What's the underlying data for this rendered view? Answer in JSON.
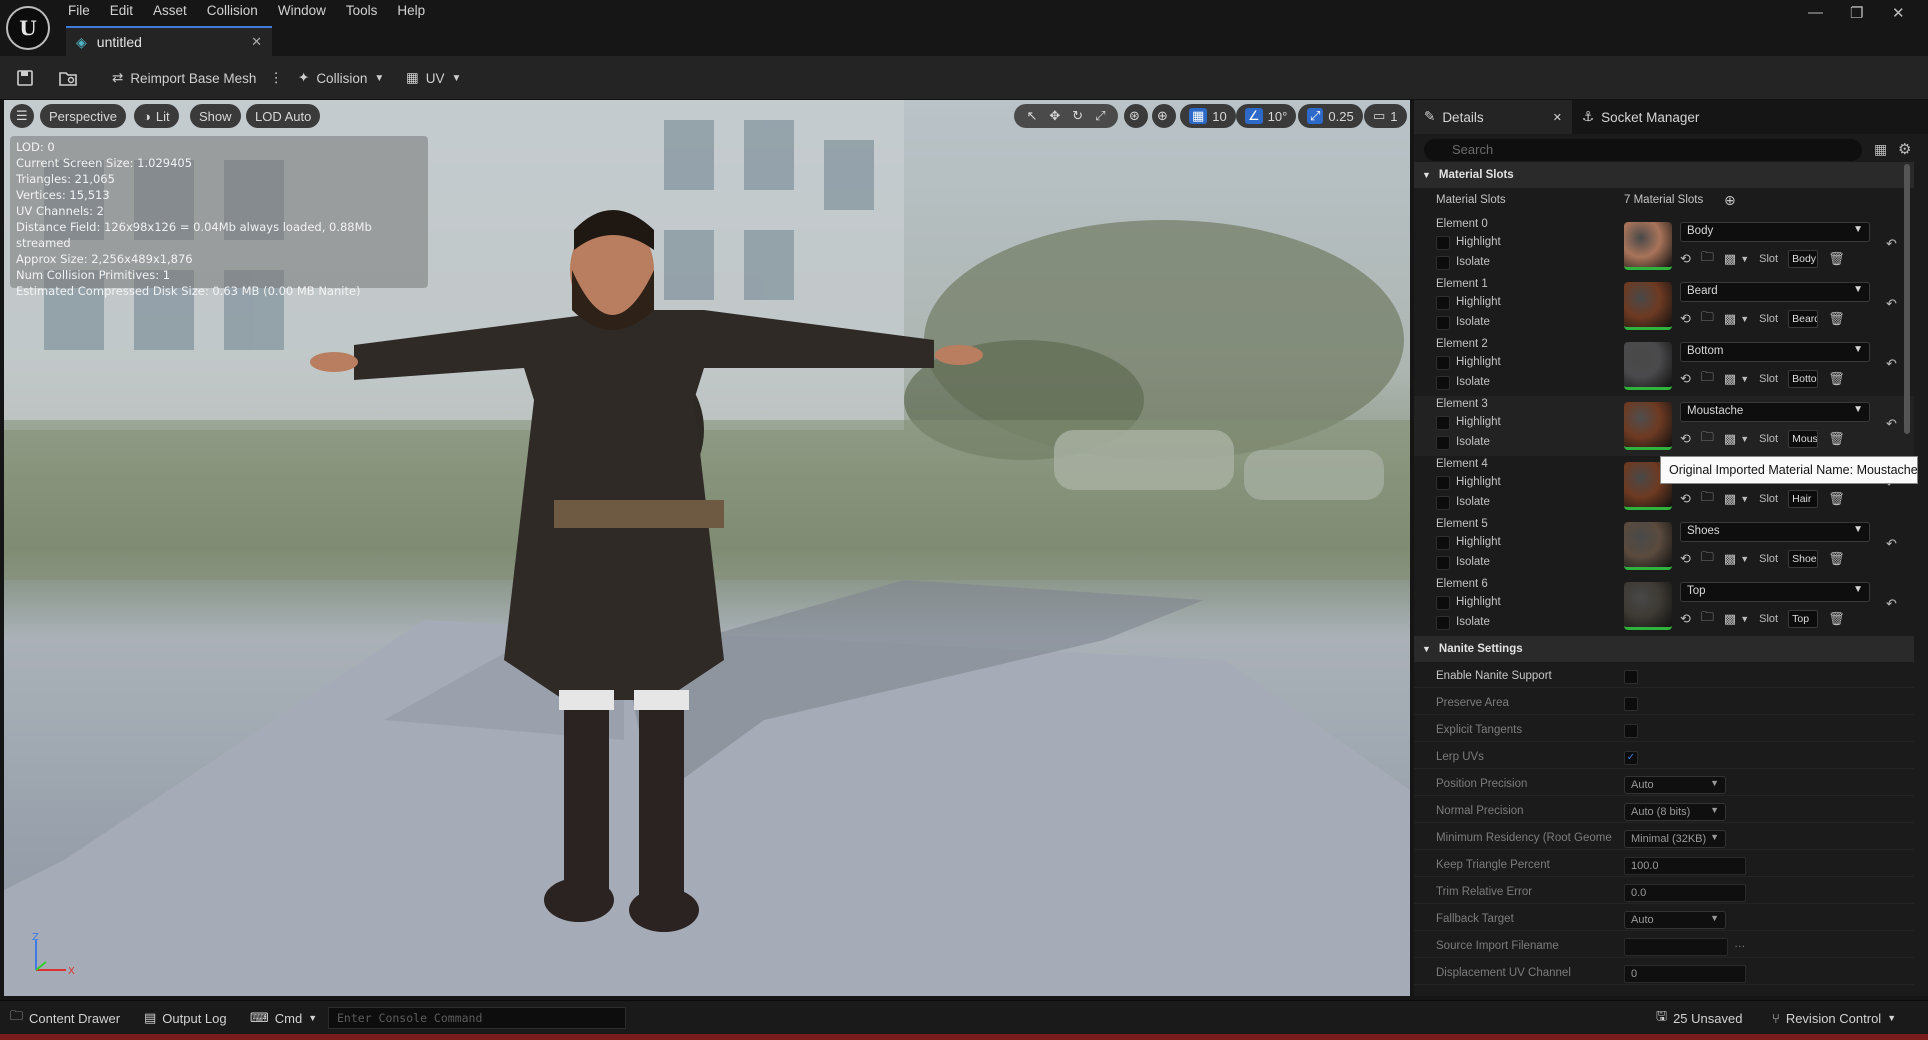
{
  "window": {
    "tab_title": "untitled",
    "menu": [
      "File",
      "Edit",
      "Asset",
      "Collision",
      "Window",
      "Tools",
      "Help"
    ],
    "controls": {
      "minimize": "—",
      "restore": "❐",
      "close": "✕"
    }
  },
  "toolbar": {
    "reimport": "Reimport Base Mesh",
    "collision": "Collision",
    "uv": "UV"
  },
  "viewport": {
    "buttons": {
      "perspective": "Perspective",
      "lit": "Lit",
      "show": "Show",
      "lod": "LOD Auto"
    },
    "right_controls": {
      "grid": "10",
      "angle": "10°",
      "scale": "0.25",
      "camera": "1"
    },
    "stats": [
      "LOD:  0",
      "Current Screen Size:  1.029405",
      "Triangles:  21,065",
      "Vertices:  15,513",
      "UV Channels:  2",
      "Distance Field:  126x98x126 = 0.04Mb always loaded, 0.88Mb streamed",
      "Approx Size: 2,256x489x1,876",
      "Num Collision Primitives:  1",
      "Estimated Compressed Disk Size: 0.63 MB (0.00 MB Nanite)"
    ],
    "axes": {
      "z": "Z",
      "x": "X"
    }
  },
  "details": {
    "tab_details": "Details",
    "tab_socket": "Socket Manager",
    "search_placeholder": "Search",
    "material_slots_header": "Material Slots",
    "material_slots_label": "Material Slots",
    "material_slots_count": "7 Material Slots",
    "highlight": "Highlight",
    "isolate": "Isolate",
    "slot": "Slot",
    "elements": [
      {
        "label": "Element 0",
        "material": "Body",
        "slot": "Body",
        "thumb": "#a9745a"
      },
      {
        "label": "Element 1",
        "material": "Beard",
        "slot": "Beard",
        "thumb": "#6e3a22"
      },
      {
        "label": "Element 2",
        "material": "Bottom",
        "slot": "Bottom",
        "thumb": "#4a4a4c"
      },
      {
        "label": "Element 3",
        "material": "Moustache",
        "slot": "Moustache",
        "thumb": "#6e3a22"
      },
      {
        "label": "Element 4",
        "material": "",
        "slot": "Hair",
        "thumb": "#6e3a22"
      },
      {
        "label": "Element 5",
        "material": "Shoes",
        "slot": "Shoes",
        "thumb": "#5a4b3e"
      },
      {
        "label": "Element 6",
        "material": "Top",
        "slot": "Top",
        "thumb": "#3e3a34"
      }
    ],
    "tooltip": "Original Imported Material Name: Moustache",
    "nanite_header": "Nanite Settings",
    "nanite": {
      "enable": "Enable Nanite Support",
      "preserve": "Preserve Area",
      "tangents": "Explicit Tangents",
      "lerp": "Lerp UVs",
      "position_label": "Position Precision",
      "position_value": "Auto",
      "normal_label": "Normal Precision",
      "normal_value": "Auto (8 bits)",
      "residency_label": "Minimum Residency (Root Geome",
      "residency_value": "Minimal (32KB)",
      "keep_label": "Keep Triangle Percent",
      "keep_value": "100.0",
      "trim_label": "Trim Relative Error",
      "trim_value": "0.0",
      "fallback_label": "Fallback Target",
      "fallback_value": "Auto",
      "source_label": "Source Import Filename",
      "source_value": "",
      "displacement_label": "Displacement UV Channel",
      "displacement_value": "0"
    }
  },
  "statusbar": {
    "content_drawer": "Content Drawer",
    "output_log": "Output Log",
    "cmd": "Cmd",
    "console_placeholder": "Enter Console Command",
    "unsaved": "25 Unsaved",
    "revision": "Revision Control"
  }
}
